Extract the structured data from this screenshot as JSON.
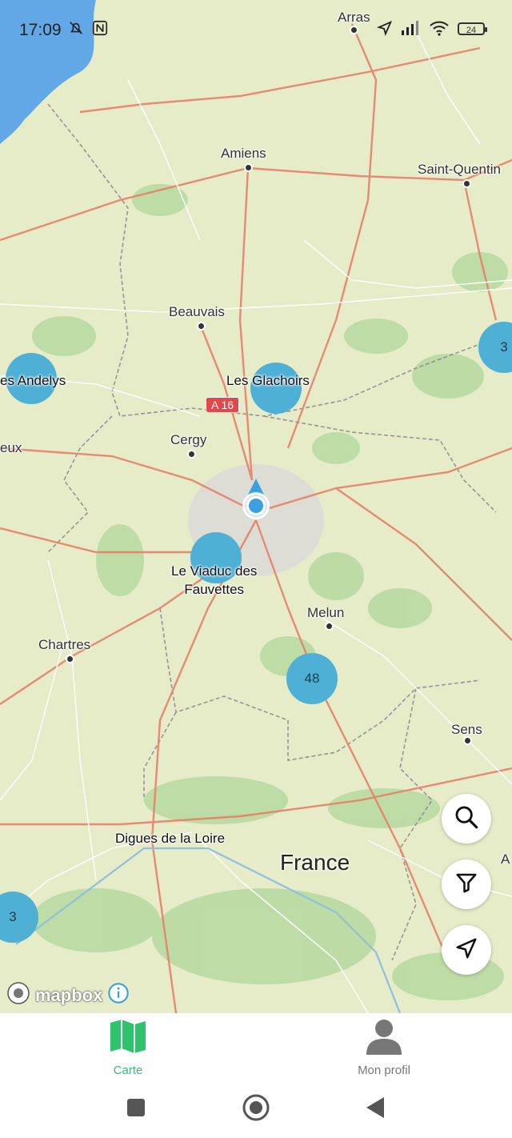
{
  "status_bar": {
    "time": "17:09",
    "battery": "24",
    "icons": [
      "mute-bell-icon",
      "nfc-icon",
      "location-arrow-icon",
      "signal-icon",
      "wifi-icon",
      "battery-icon"
    ]
  },
  "map": {
    "cities": [
      "Arras",
      "Amiens",
      "Saint-Quentin",
      "Beauvais",
      "Cergy",
      "Melun",
      "Chartres",
      "Sens"
    ],
    "edge_labels": [
      "eux",
      "A"
    ],
    "road_shield": "A 16",
    "country": "France",
    "clusters": [
      {
        "label": "3"
      },
      {
        "label": "48"
      },
      {
        "label": "3"
      }
    ],
    "markers": [
      {
        "label": "es Andelys"
      },
      {
        "label": "Les Glachoirs"
      },
      {
        "label": "Le Viaduc des\nFauvettes"
      },
      {
        "label": "Digues de la Loire"
      }
    ],
    "attribution": "mapbox",
    "colors": {
      "cluster": "#4fb0d6",
      "water": "#62a8e6",
      "land": "#e6ebc8",
      "forest": "#b6d9a0",
      "road": "#e8806a"
    }
  },
  "fabs": [
    {
      "icon": "search-icon"
    },
    {
      "icon": "filter-icon"
    },
    {
      "icon": "navigation-arrow-icon"
    }
  ],
  "bottom_nav": {
    "tabs": [
      {
        "label": "Carte",
        "icon": "map-icon",
        "active": true,
        "color": "#2ec46e"
      },
      {
        "label": "Mon profil",
        "icon": "person-icon",
        "active": false,
        "color": "#777777"
      }
    ]
  },
  "system_nav": [
    "recents-square-icon",
    "home-circle-icon",
    "back-triangle-icon"
  ]
}
